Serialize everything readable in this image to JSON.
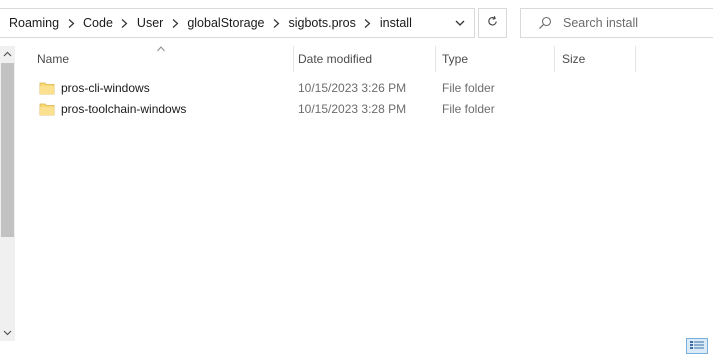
{
  "address_bar": {
    "crumbs": [
      "Roaming",
      "Code",
      "User",
      "globalStorage",
      "sigbots.pros",
      "install"
    ]
  },
  "search": {
    "placeholder": "Search install"
  },
  "columns": {
    "name": "Name",
    "date_modified": "Date modified",
    "type": "Type",
    "size": "Size"
  },
  "files": [
    {
      "name": "pros-cli-windows",
      "date_modified": "10/15/2023 3:26 PM",
      "type": "File folder",
      "size": ""
    },
    {
      "name": "pros-toolchain-windows",
      "date_modified": "10/15/2023 3:28 PM",
      "type": "File folder",
      "size": ""
    }
  ],
  "icons": {
    "folder": "folder-icon",
    "search": "search-icon",
    "refresh": "refresh-icon",
    "dropdown": "chevron-down-icon",
    "separator": "chevron-right-icon",
    "view_toggle": "details-view-icon"
  },
  "colors": {
    "folder_yellow": "#f8d775",
    "selected_view_bg": "#dbeaf7"
  }
}
